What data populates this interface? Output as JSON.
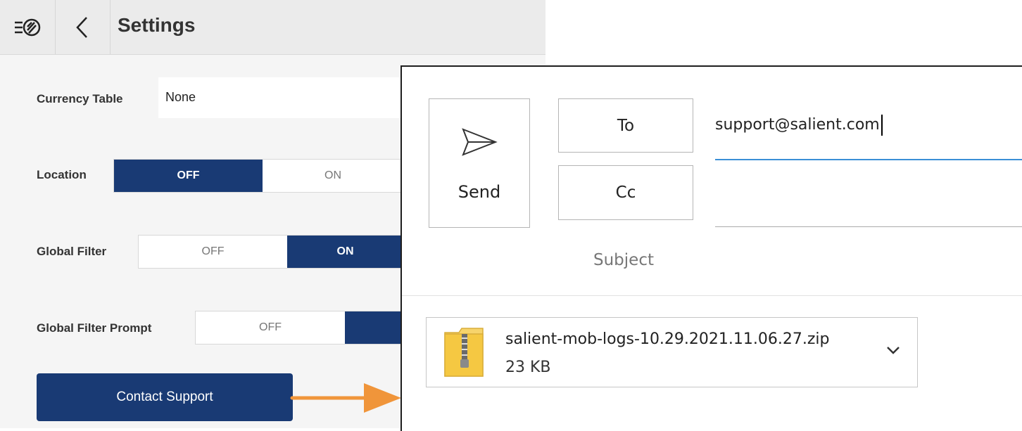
{
  "settings": {
    "title": "Settings",
    "currency_table": {
      "label": "Currency Table",
      "value": "None"
    },
    "location": {
      "label": "Location",
      "off": "OFF",
      "on": "ON",
      "selected": "OFF"
    },
    "global_filter": {
      "label": "Global Filter",
      "off": "OFF",
      "on": "ON",
      "selected": "ON"
    },
    "global_filter_prompt": {
      "label": "Global Filter Prompt",
      "off": "OFF",
      "selected": "ON"
    },
    "contact_support_label": "Contact Support",
    "accent_color": "#193a74"
  },
  "arrow_color": "#f0953a",
  "email": {
    "send_label": "Send",
    "to_label": "To",
    "cc_label": "Cc",
    "to_value": "support@salient.com",
    "cc_value": "",
    "subject_placeholder": "Subject",
    "attachment": {
      "name": "salient-mob-logs-10.29.2021.11.06.27.zip",
      "size": "23 KB",
      "icon": "zip-folder-icon"
    },
    "focus_line_color": "#3a8fd6"
  }
}
